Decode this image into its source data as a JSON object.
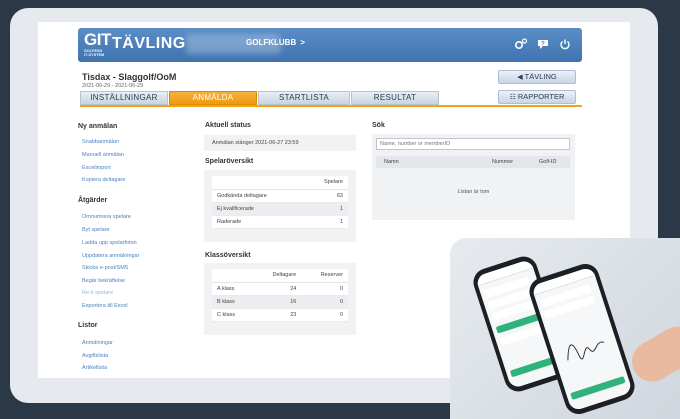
{
  "header": {
    "logo_main": "GIT",
    "logo_sub": "GOLFENS IT-SYSTEM",
    "app_name": "TÄVLING",
    "club": "GOLFKLUBB",
    "club_arrow": ">",
    "icons": [
      "settings-icon",
      "help-icon",
      "power-icon"
    ]
  },
  "competition": {
    "title": "Tisdax - Slaggolf/OoM",
    "dates": "2021-06-29 - 2021-06-29"
  },
  "tabs": [
    {
      "label": "INSTÄLLNINGAR",
      "active": false
    },
    {
      "label": "ANMÄLDA",
      "active": true
    },
    {
      "label": "STARTLISTA",
      "active": false
    },
    {
      "label": "RESULTAT",
      "active": false
    }
  ],
  "right_buttons": {
    "tavling": "TÄVLING",
    "rapporter": "RAPPORTER"
  },
  "left_menu": {
    "new_heading": "Ny anmälan",
    "new_items": [
      "Snabbanmälan",
      "Manuell anmälan",
      "Excelimport",
      "Kopiera deltagare"
    ],
    "actions_heading": "Åtgärder",
    "action_items": [
      {
        "label": "Omnumrera spelare",
        "enabled": true
      },
      {
        "label": "Byt spelare",
        "enabled": true
      },
      {
        "label": "Ladda upp spelarfoton",
        "enabled": true
      },
      {
        "label": "Uppdatera anmälningar",
        "enabled": true
      },
      {
        "label": "Skicka e-post/SMS",
        "enabled": true
      },
      {
        "label": "Begär bekräftelse",
        "enabled": true
      },
      {
        "label": "Re-it spelare",
        "enabled": false
      },
      {
        "label": "Exportera till Excel",
        "enabled": true
      }
    ],
    "lists_heading": "Listor",
    "list_items": [
      "Anmälningar",
      "Avgiftslista",
      "Artikellista"
    ]
  },
  "status": {
    "heading": "Aktuell status",
    "text": "Anmälan stänger 2021-06-27 23:59"
  },
  "players": {
    "heading": "Spelaröversikt",
    "column": "Spelare",
    "rows": [
      {
        "label": "Godkända deltagare",
        "value": "63"
      },
      {
        "label": "Ej kvalificerade",
        "value": "1"
      },
      {
        "label": "Raderade",
        "value": "1"
      }
    ]
  },
  "classes": {
    "heading": "Klassöversikt",
    "columns": [
      "Deltagare",
      "Reserver"
    ],
    "rows": [
      {
        "label": "A klass",
        "participants": "24",
        "reserves": "0"
      },
      {
        "label": "B klass",
        "participants": "16",
        "reserves": "0"
      },
      {
        "label": "C klass",
        "participants": "23",
        "reserves": "0"
      }
    ]
  },
  "search": {
    "heading": "Sök",
    "placeholder": "Name, number or memberID",
    "columns": [
      "Namn",
      "Nummer",
      "Golf-ID"
    ],
    "empty": "Listan är tom"
  },
  "colors": {
    "accent": "#f3a21d",
    "header_blue": "#4a7fbd",
    "link": "#4a82c4",
    "background": "#2a3848"
  }
}
